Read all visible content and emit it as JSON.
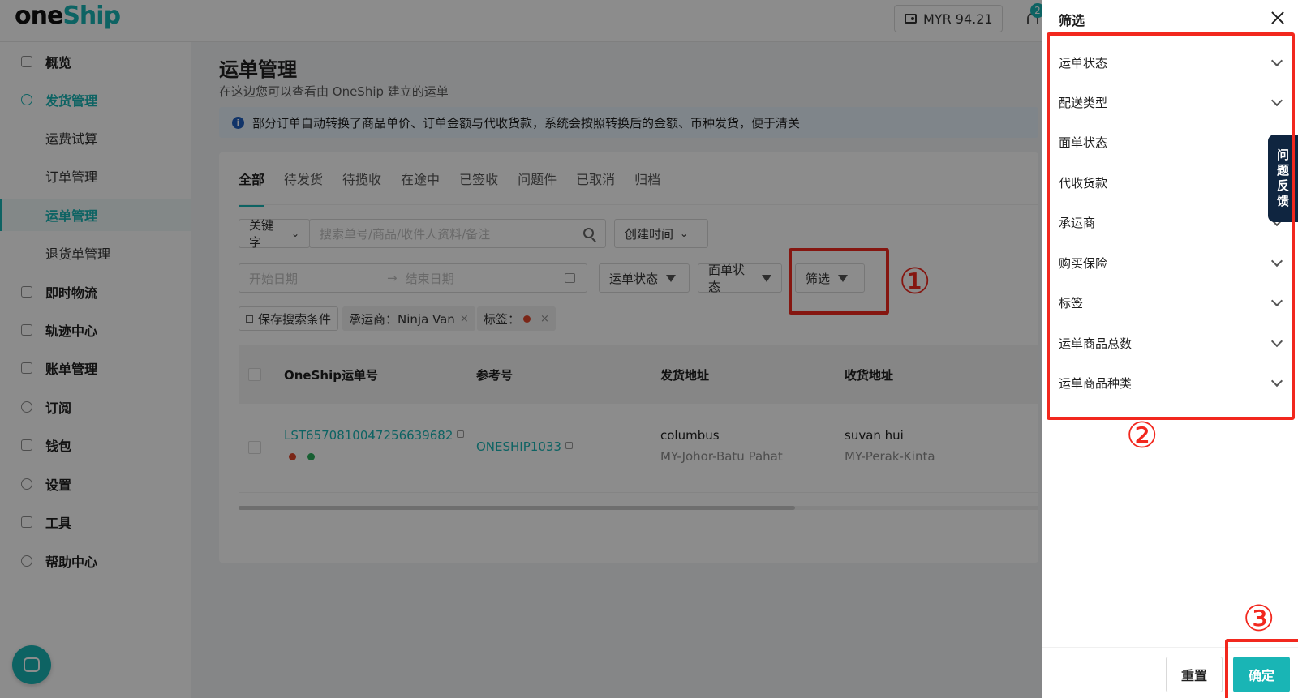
{
  "brand": {
    "logo_one": "one",
    "logo_ship": "Ship",
    "accent_color": "#19b5b5"
  },
  "header": {
    "balance": "MYR 94.21",
    "notification_count": "2"
  },
  "sidebar": {
    "items": [
      {
        "label": "概览",
        "icon": "grid-icon"
      },
      {
        "label": "发货管理",
        "icon": "rocket-icon"
      },
      {
        "label": "运费试算"
      },
      {
        "label": "订单管理"
      },
      {
        "label": "运单管理"
      },
      {
        "label": "退货单管理"
      },
      {
        "label": "即时物流",
        "icon": "truck-icon"
      },
      {
        "label": "轨迹中心",
        "icon": "send-icon"
      },
      {
        "label": "账单管理",
        "icon": "bill-icon"
      },
      {
        "label": "订阅",
        "icon": "user-icon"
      },
      {
        "label": "钱包",
        "icon": "wallet-icon"
      },
      {
        "label": "设置",
        "icon": "gear-icon"
      },
      {
        "label": "工具",
        "icon": "tools-icon"
      },
      {
        "label": "帮助中心",
        "icon": "help-icon"
      }
    ]
  },
  "main": {
    "title": "运单管理",
    "subtitle": "在这边您可以查看由 OneShip 建立的运单",
    "notice": "部分订单自动转换了商品单价、订单金额与代收货款，系统会按照转换后的金额、币种发货，便于清关",
    "tabs": [
      "全部",
      "待发货",
      "待揽收",
      "在途中",
      "已签收",
      "问题件",
      "已取消",
      "归档"
    ],
    "search": {
      "keyword_select": "关键字",
      "placeholder": "搜索单号/商品/收件人资料/备注",
      "time_select": "创建时间",
      "start_date": "开始日期",
      "end_date": "结束日期",
      "arrow": "→",
      "status_filter": "运单状态",
      "label_filter": "面单状态",
      "filter_button": "筛选"
    },
    "saved": {
      "save_label": "保存搜索条件",
      "carrier_chip": "承运商：Ninja Van",
      "tag_chip": "标签："
    },
    "table": {
      "headers": [
        "OneShip运单号",
        "参考号",
        "发货地址",
        "收货地址"
      ],
      "rows": [
        {
          "tracking": "LST6570810047256639682",
          "ref": "ONESHIP1033",
          "from_name": "columbus",
          "from_region": "MY-Johor-Batu Pahat",
          "to_name": "suvan hui",
          "to_region": "MY-Perak-Kinta"
        }
      ]
    }
  },
  "drawer": {
    "title": "筛选",
    "items": [
      "运单状态",
      "配送类型",
      "面单状态",
      "代收货款",
      "承运商",
      "购买保险",
      "标签",
      "运单商品总数",
      "运单商品种类"
    ],
    "feedback": [
      "问",
      "题",
      "反",
      "馈"
    ],
    "reset": "重置",
    "confirm": "确定"
  },
  "annotations": {
    "one": "①",
    "two": "②",
    "three": "③",
    "color": "#f2281e"
  }
}
